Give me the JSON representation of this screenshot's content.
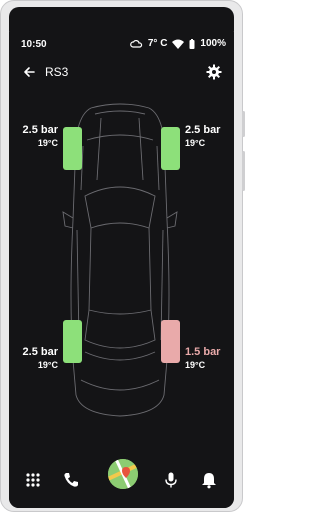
{
  "status_bar": {
    "time": "10:50",
    "weather_temp": "7° C",
    "battery": "100%"
  },
  "app_bar": {
    "title": "RS3"
  },
  "tires": {
    "front_left": {
      "pressure": "2.5 bar",
      "temperature": "19°C",
      "status": "ok"
    },
    "front_right": {
      "pressure": "2.5 bar",
      "temperature": "19°C",
      "status": "ok"
    },
    "rear_left": {
      "pressure": "2.5 bar",
      "temperature": "19°C",
      "status": "ok"
    },
    "rear_right": {
      "pressure": "1.5 bar",
      "temperature": "19°C",
      "status": "low"
    }
  },
  "colors": {
    "background": "#141416",
    "tire_ok": "#8de07a",
    "tire_low": "#e9aaaa",
    "text": "#ffffff"
  },
  "icons": {
    "back": "arrow-back-icon",
    "settings": "gear-icon",
    "weather": "cloud-sun-icon",
    "wifi": "wifi-icon",
    "battery": "battery-icon",
    "apps": "grid-icon",
    "phone": "phone-icon",
    "maps": "maps-icon",
    "voice": "microphone-icon",
    "notifications": "bell-icon"
  }
}
